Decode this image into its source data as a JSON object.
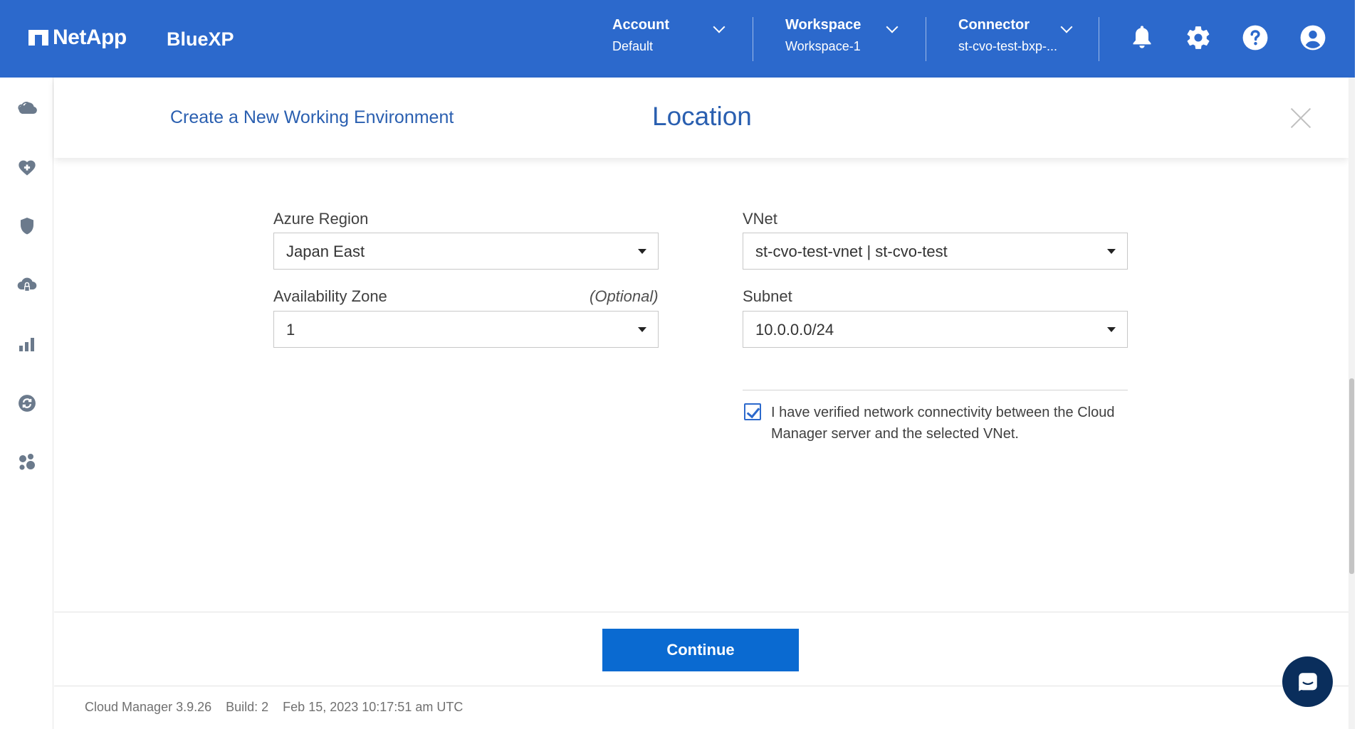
{
  "header": {
    "brand": "NetApp",
    "product": "BlueXP",
    "account": {
      "label": "Account",
      "value": "Default"
    },
    "workspace": {
      "label": "Workspace",
      "value": "Workspace-1"
    },
    "connector": {
      "label": "Connector",
      "value": "st-cvo-test-bxp-..."
    },
    "icons": [
      "bell-icon",
      "gear-icon",
      "help-icon",
      "user-icon"
    ],
    "background_color": "#2c69cc"
  },
  "sidebar": {
    "icons": [
      "cloud-icon",
      "health-icon",
      "shield-icon",
      "cloud-lock-icon",
      "bar-chart-icon",
      "sync-icon",
      "hexagons-icon"
    ]
  },
  "panel": {
    "subtitle": "Create a New Working Environment",
    "title": "Location"
  },
  "form": {
    "azure_region": {
      "label": "Azure Region",
      "value": "Japan East"
    },
    "availability_zone": {
      "label": "Availability Zone",
      "optional": "(Optional)",
      "value": "1"
    },
    "vnet": {
      "label": "VNet",
      "value": "st-cvo-test-vnet | st-cvo-test"
    },
    "subnet": {
      "label": "Subnet",
      "value": "10.0.0.0/24"
    },
    "verify": {
      "checked": true,
      "text": "I have verified network connectivity between the Cloud Manager server and the selected VNet."
    }
  },
  "actions": {
    "continue_label": "Continue",
    "accent": "#0a6ad1"
  },
  "status": {
    "version": "Cloud Manager 3.9.26",
    "build": "Build: 2",
    "timestamp": "Feb 15, 2023 10:17:51 am UTC"
  }
}
